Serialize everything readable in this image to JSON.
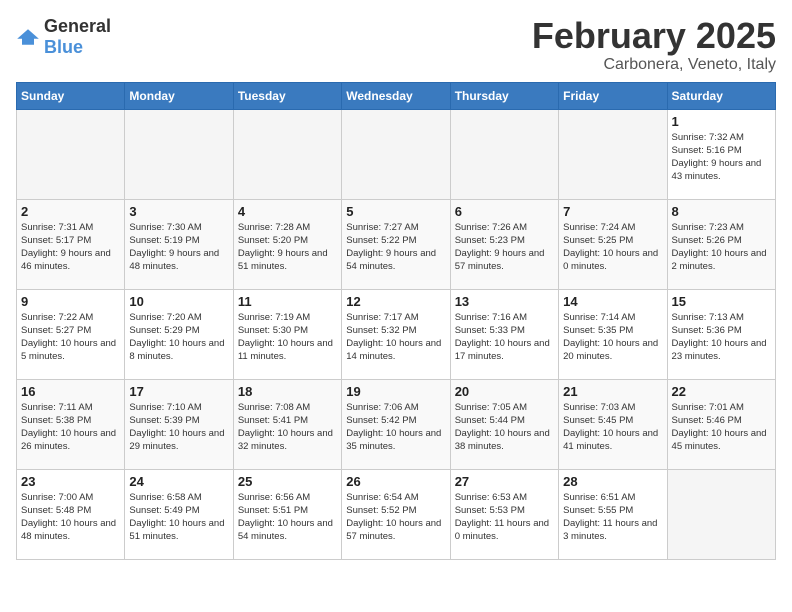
{
  "header": {
    "logo_general": "General",
    "logo_blue": "Blue",
    "month_year": "February 2025",
    "location": "Carbonera, Veneto, Italy"
  },
  "weekdays": [
    "Sunday",
    "Monday",
    "Tuesday",
    "Wednesday",
    "Thursday",
    "Friday",
    "Saturday"
  ],
  "weeks": [
    [
      {
        "day": "",
        "info": ""
      },
      {
        "day": "",
        "info": ""
      },
      {
        "day": "",
        "info": ""
      },
      {
        "day": "",
        "info": ""
      },
      {
        "day": "",
        "info": ""
      },
      {
        "day": "",
        "info": ""
      },
      {
        "day": "1",
        "info": "Sunrise: 7:32 AM\nSunset: 5:16 PM\nDaylight: 9 hours and 43 minutes."
      }
    ],
    [
      {
        "day": "2",
        "info": "Sunrise: 7:31 AM\nSunset: 5:17 PM\nDaylight: 9 hours and 46 minutes."
      },
      {
        "day": "3",
        "info": "Sunrise: 7:30 AM\nSunset: 5:19 PM\nDaylight: 9 hours and 48 minutes."
      },
      {
        "day": "4",
        "info": "Sunrise: 7:28 AM\nSunset: 5:20 PM\nDaylight: 9 hours and 51 minutes."
      },
      {
        "day": "5",
        "info": "Sunrise: 7:27 AM\nSunset: 5:22 PM\nDaylight: 9 hours and 54 minutes."
      },
      {
        "day": "6",
        "info": "Sunrise: 7:26 AM\nSunset: 5:23 PM\nDaylight: 9 hours and 57 minutes."
      },
      {
        "day": "7",
        "info": "Sunrise: 7:24 AM\nSunset: 5:25 PM\nDaylight: 10 hours and 0 minutes."
      },
      {
        "day": "8",
        "info": "Sunrise: 7:23 AM\nSunset: 5:26 PM\nDaylight: 10 hours and 2 minutes."
      }
    ],
    [
      {
        "day": "9",
        "info": "Sunrise: 7:22 AM\nSunset: 5:27 PM\nDaylight: 10 hours and 5 minutes."
      },
      {
        "day": "10",
        "info": "Sunrise: 7:20 AM\nSunset: 5:29 PM\nDaylight: 10 hours and 8 minutes."
      },
      {
        "day": "11",
        "info": "Sunrise: 7:19 AM\nSunset: 5:30 PM\nDaylight: 10 hours and 11 minutes."
      },
      {
        "day": "12",
        "info": "Sunrise: 7:17 AM\nSunset: 5:32 PM\nDaylight: 10 hours and 14 minutes."
      },
      {
        "day": "13",
        "info": "Sunrise: 7:16 AM\nSunset: 5:33 PM\nDaylight: 10 hours and 17 minutes."
      },
      {
        "day": "14",
        "info": "Sunrise: 7:14 AM\nSunset: 5:35 PM\nDaylight: 10 hours and 20 minutes."
      },
      {
        "day": "15",
        "info": "Sunrise: 7:13 AM\nSunset: 5:36 PM\nDaylight: 10 hours and 23 minutes."
      }
    ],
    [
      {
        "day": "16",
        "info": "Sunrise: 7:11 AM\nSunset: 5:38 PM\nDaylight: 10 hours and 26 minutes."
      },
      {
        "day": "17",
        "info": "Sunrise: 7:10 AM\nSunset: 5:39 PM\nDaylight: 10 hours and 29 minutes."
      },
      {
        "day": "18",
        "info": "Sunrise: 7:08 AM\nSunset: 5:41 PM\nDaylight: 10 hours and 32 minutes."
      },
      {
        "day": "19",
        "info": "Sunrise: 7:06 AM\nSunset: 5:42 PM\nDaylight: 10 hours and 35 minutes."
      },
      {
        "day": "20",
        "info": "Sunrise: 7:05 AM\nSunset: 5:44 PM\nDaylight: 10 hours and 38 minutes."
      },
      {
        "day": "21",
        "info": "Sunrise: 7:03 AM\nSunset: 5:45 PM\nDaylight: 10 hours and 41 minutes."
      },
      {
        "day": "22",
        "info": "Sunrise: 7:01 AM\nSunset: 5:46 PM\nDaylight: 10 hours and 45 minutes."
      }
    ],
    [
      {
        "day": "23",
        "info": "Sunrise: 7:00 AM\nSunset: 5:48 PM\nDaylight: 10 hours and 48 minutes."
      },
      {
        "day": "24",
        "info": "Sunrise: 6:58 AM\nSunset: 5:49 PM\nDaylight: 10 hours and 51 minutes."
      },
      {
        "day": "25",
        "info": "Sunrise: 6:56 AM\nSunset: 5:51 PM\nDaylight: 10 hours and 54 minutes."
      },
      {
        "day": "26",
        "info": "Sunrise: 6:54 AM\nSunset: 5:52 PM\nDaylight: 10 hours and 57 minutes."
      },
      {
        "day": "27",
        "info": "Sunrise: 6:53 AM\nSunset: 5:53 PM\nDaylight: 11 hours and 0 minutes."
      },
      {
        "day": "28",
        "info": "Sunrise: 6:51 AM\nSunset: 5:55 PM\nDaylight: 11 hours and 3 minutes."
      },
      {
        "day": "",
        "info": ""
      }
    ]
  ]
}
